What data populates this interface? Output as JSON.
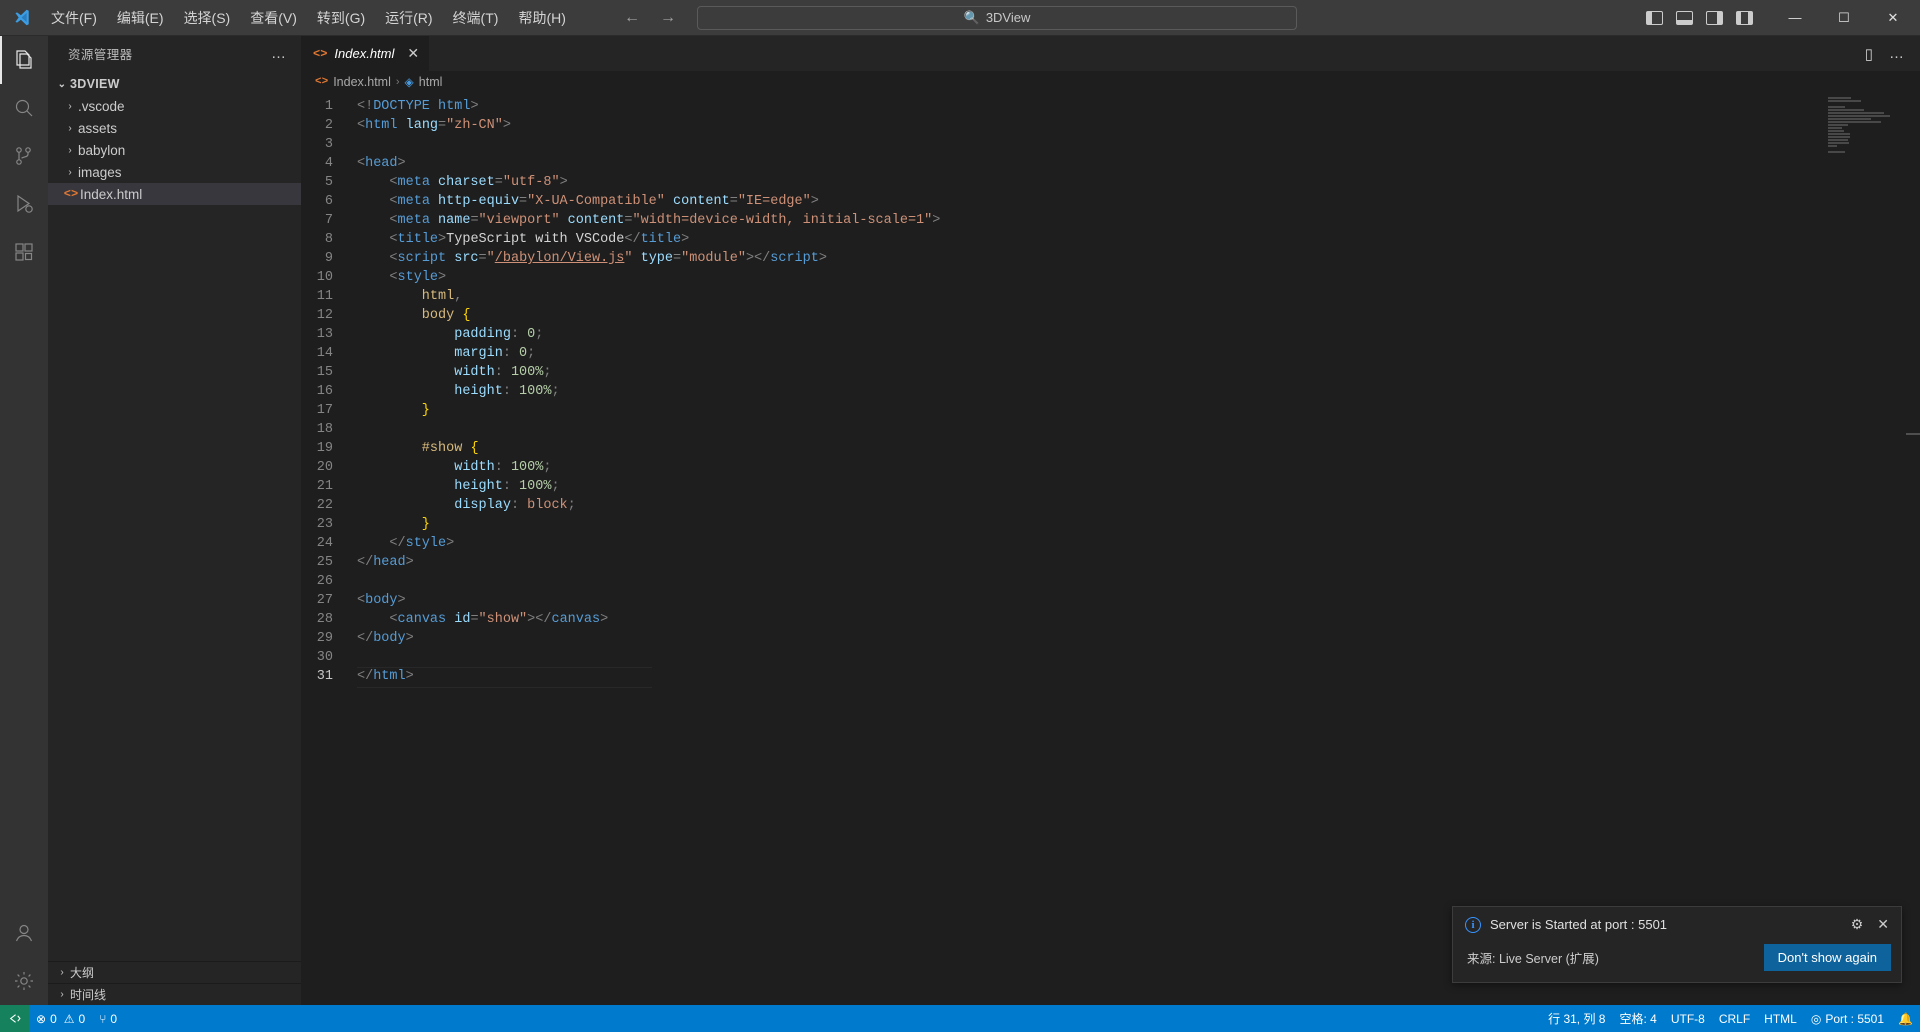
{
  "titlebar": {
    "menus": [
      "文件(F)",
      "编辑(E)",
      "选择(S)",
      "查看(V)",
      "转到(G)",
      "运行(R)",
      "终端(T)",
      "帮助(H)"
    ],
    "back_icon": "←",
    "forward_icon": "→",
    "search_icon": "search-icon",
    "search_text": "3DView",
    "minimize": "—",
    "maximize": "☐",
    "close": "✕"
  },
  "activitybar": {
    "items": [
      {
        "name": "explorer",
        "icon": "files-icon",
        "active": true
      },
      {
        "name": "search",
        "icon": "search-icon",
        "active": false
      },
      {
        "name": "source-control",
        "icon": "source-control-icon",
        "active": false
      },
      {
        "name": "run-debug",
        "icon": "run-debug-icon",
        "active": false
      },
      {
        "name": "extensions",
        "icon": "extensions-icon",
        "active": false
      }
    ],
    "bottom": [
      {
        "name": "accounts",
        "icon": "account-icon"
      },
      {
        "name": "settings",
        "icon": "gear-icon"
      }
    ]
  },
  "sidebar": {
    "title": "资源管理器",
    "more_actions": "…",
    "root": {
      "label": "3DVIEW",
      "twisty": "⌄"
    },
    "items": [
      {
        "label": ".vscode",
        "twisty": "›",
        "icon": "folder-icon",
        "selected": false
      },
      {
        "label": "assets",
        "twisty": "›",
        "icon": "folder-icon",
        "selected": false
      },
      {
        "label": "babylon",
        "twisty": "›",
        "icon": "folder-icon",
        "selected": false
      },
      {
        "label": "images",
        "twisty": "›",
        "icon": "folder-icon",
        "selected": false
      },
      {
        "label": "Index.html",
        "twisty": "",
        "icon": "html-file-icon",
        "selected": true
      }
    ],
    "panels": [
      {
        "label": "大纲",
        "twisty": "›"
      },
      {
        "label": "时间线",
        "twisty": "›"
      }
    ]
  },
  "editor": {
    "tab": {
      "label": "Index.html",
      "icon": "html-file-icon",
      "close": "✕"
    },
    "tab_actions": [
      {
        "name": "split-editor-icon",
        "glyph": "▯"
      },
      {
        "name": "more-actions-icon",
        "glyph": "…"
      }
    ],
    "breadcrumb": [
      {
        "label": "Index.html",
        "icon": "html-file-icon"
      },
      {
        "label": "html",
        "icon": "symbol-cube-icon"
      }
    ],
    "breadcrumb_separator": "›",
    "lines": [
      {
        "n": 1,
        "tokens": [
          {
            "c": "b",
            "t": "<!"
          },
          {
            "c": "t",
            "t": "DOCTYPE"
          },
          {
            "c": "txt",
            "t": " "
          },
          {
            "c": "t",
            "t": "html"
          },
          {
            "c": "b",
            "t": ">"
          }
        ]
      },
      {
        "n": 2,
        "tokens": [
          {
            "c": "b",
            "t": "<"
          },
          {
            "c": "t",
            "t": "html"
          },
          {
            "c": "txt",
            "t": " "
          },
          {
            "c": "a",
            "t": "lang"
          },
          {
            "c": "b",
            "t": "="
          },
          {
            "c": "s",
            "t": "\"zh-CN\""
          },
          {
            "c": "b",
            "t": ">"
          }
        ]
      },
      {
        "n": 3,
        "tokens": []
      },
      {
        "n": 4,
        "tokens": [
          {
            "c": "b",
            "t": "<"
          },
          {
            "c": "t",
            "t": "head"
          },
          {
            "c": "b",
            "t": ">"
          }
        ]
      },
      {
        "n": 5,
        "tokens": [
          {
            "c": "b",
            "t": "    <"
          },
          {
            "c": "t",
            "t": "meta"
          },
          {
            "c": "txt",
            "t": " "
          },
          {
            "c": "a",
            "t": "charset"
          },
          {
            "c": "b",
            "t": "="
          },
          {
            "c": "s",
            "t": "\"utf-8\""
          },
          {
            "c": "b",
            "t": ">"
          }
        ]
      },
      {
        "n": 6,
        "tokens": [
          {
            "c": "b",
            "t": "    <"
          },
          {
            "c": "t",
            "t": "meta"
          },
          {
            "c": "txt",
            "t": " "
          },
          {
            "c": "a",
            "t": "http-equiv"
          },
          {
            "c": "b",
            "t": "="
          },
          {
            "c": "s",
            "t": "\"X-UA-Compatible\""
          },
          {
            "c": "txt",
            "t": " "
          },
          {
            "c": "a",
            "t": "content"
          },
          {
            "c": "b",
            "t": "="
          },
          {
            "c": "s",
            "t": "\"IE=edge\""
          },
          {
            "c": "b",
            "t": ">"
          }
        ]
      },
      {
        "n": 7,
        "tokens": [
          {
            "c": "b",
            "t": "    <"
          },
          {
            "c": "t",
            "t": "meta"
          },
          {
            "c": "txt",
            "t": " "
          },
          {
            "c": "a",
            "t": "name"
          },
          {
            "c": "b",
            "t": "="
          },
          {
            "c": "s",
            "t": "\"viewport\""
          },
          {
            "c": "txt",
            "t": " "
          },
          {
            "c": "a",
            "t": "content"
          },
          {
            "c": "b",
            "t": "="
          },
          {
            "c": "s",
            "t": "\"width=device-width, initial-scale=1\""
          },
          {
            "c": "b",
            "t": ">"
          }
        ]
      },
      {
        "n": 8,
        "tokens": [
          {
            "c": "b",
            "t": "    <"
          },
          {
            "c": "t",
            "t": "title"
          },
          {
            "c": "b",
            "t": ">"
          },
          {
            "c": "txt",
            "t": "TypeScript with VSCode"
          },
          {
            "c": "b",
            "t": "</"
          },
          {
            "c": "t",
            "t": "title"
          },
          {
            "c": "b",
            "t": ">"
          }
        ]
      },
      {
        "n": 9,
        "tokens": [
          {
            "c": "b",
            "t": "    <"
          },
          {
            "c": "t",
            "t": "script"
          },
          {
            "c": "txt",
            "t": " "
          },
          {
            "c": "a",
            "t": "src"
          },
          {
            "c": "b",
            "t": "="
          },
          {
            "c": "s",
            "t": "\""
          },
          {
            "c": "lnk",
            "t": "/babylon/View.js"
          },
          {
            "c": "s",
            "t": "\""
          },
          {
            "c": "txt",
            "t": " "
          },
          {
            "c": "a",
            "t": "type"
          },
          {
            "c": "b",
            "t": "="
          },
          {
            "c": "s",
            "t": "\"module\""
          },
          {
            "c": "b",
            "t": "></"
          },
          {
            "c": "t",
            "t": "script"
          },
          {
            "c": "b",
            "t": ">"
          }
        ]
      },
      {
        "n": 10,
        "tokens": [
          {
            "c": "b",
            "t": "    <"
          },
          {
            "c": "t",
            "t": "style"
          },
          {
            "c": "b",
            "t": ">"
          }
        ]
      },
      {
        "n": 11,
        "tokens": [
          {
            "c": "sel",
            "t": "        html"
          },
          {
            "c": "b",
            "t": ","
          }
        ]
      },
      {
        "n": 12,
        "tokens": [
          {
            "c": "sel",
            "t": "        body"
          },
          {
            "c": "txt",
            "t": " "
          },
          {
            "c": "br",
            "t": "{"
          }
        ]
      },
      {
        "n": 13,
        "tokens": [
          {
            "c": "a",
            "t": "            padding"
          },
          {
            "c": "b",
            "t": ":"
          },
          {
            "c": "txt",
            "t": " "
          },
          {
            "c": "num",
            "t": "0"
          },
          {
            "c": "b",
            "t": ";"
          }
        ]
      },
      {
        "n": 14,
        "tokens": [
          {
            "c": "a",
            "t": "            margin"
          },
          {
            "c": "b",
            "t": ":"
          },
          {
            "c": "txt",
            "t": " "
          },
          {
            "c": "num",
            "t": "0"
          },
          {
            "c": "b",
            "t": ";"
          }
        ]
      },
      {
        "n": 15,
        "tokens": [
          {
            "c": "a",
            "t": "            width"
          },
          {
            "c": "b",
            "t": ":"
          },
          {
            "c": "txt",
            "t": " "
          },
          {
            "c": "num",
            "t": "100%"
          },
          {
            "c": "b",
            "t": ";"
          }
        ]
      },
      {
        "n": 16,
        "tokens": [
          {
            "c": "a",
            "t": "            height"
          },
          {
            "c": "b",
            "t": ":"
          },
          {
            "c": "txt",
            "t": " "
          },
          {
            "c": "num",
            "t": "100%"
          },
          {
            "c": "b",
            "t": ";"
          }
        ]
      },
      {
        "n": 17,
        "tokens": [
          {
            "c": "br",
            "t": "        }"
          }
        ]
      },
      {
        "n": 18,
        "tokens": []
      },
      {
        "n": 19,
        "tokens": [
          {
            "c": "sel",
            "t": "        #show"
          },
          {
            "c": "txt",
            "t": " "
          },
          {
            "c": "br",
            "t": "{"
          }
        ]
      },
      {
        "n": 20,
        "tokens": [
          {
            "c": "a",
            "t": "            width"
          },
          {
            "c": "b",
            "t": ":"
          },
          {
            "c": "txt",
            "t": " "
          },
          {
            "c": "num",
            "t": "100%"
          },
          {
            "c": "b",
            "t": ";"
          }
        ]
      },
      {
        "n": 21,
        "tokens": [
          {
            "c": "a",
            "t": "            height"
          },
          {
            "c": "b",
            "t": ":"
          },
          {
            "c": "txt",
            "t": " "
          },
          {
            "c": "num",
            "t": "100%"
          },
          {
            "c": "b",
            "t": ";"
          }
        ]
      },
      {
        "n": 22,
        "tokens": [
          {
            "c": "a",
            "t": "            display"
          },
          {
            "c": "b",
            "t": ":"
          },
          {
            "c": "txt",
            "t": " "
          },
          {
            "c": "s",
            "t": "block"
          },
          {
            "c": "b",
            "t": ";"
          }
        ]
      },
      {
        "n": 23,
        "tokens": [
          {
            "c": "br",
            "t": "        }"
          }
        ]
      },
      {
        "n": 24,
        "tokens": [
          {
            "c": "b",
            "t": "    </"
          },
          {
            "c": "t",
            "t": "style"
          },
          {
            "c": "b",
            "t": ">"
          }
        ]
      },
      {
        "n": 25,
        "tokens": [
          {
            "c": "b",
            "t": "</"
          },
          {
            "c": "t",
            "t": "head"
          },
          {
            "c": "b",
            "t": ">"
          }
        ]
      },
      {
        "n": 26,
        "tokens": []
      },
      {
        "n": 27,
        "tokens": [
          {
            "c": "b",
            "t": "<"
          },
          {
            "c": "t",
            "t": "body"
          },
          {
            "c": "b",
            "t": ">"
          }
        ]
      },
      {
        "n": 28,
        "tokens": [
          {
            "c": "b",
            "t": "    <"
          },
          {
            "c": "t",
            "t": "canvas"
          },
          {
            "c": "txt",
            "t": " "
          },
          {
            "c": "a",
            "t": "id"
          },
          {
            "c": "b",
            "t": "="
          },
          {
            "c": "s",
            "t": "\"show\""
          },
          {
            "c": "b",
            "t": "></"
          },
          {
            "c": "t",
            "t": "canvas"
          },
          {
            "c": "b",
            "t": ">"
          }
        ]
      },
      {
        "n": 29,
        "tokens": [
          {
            "c": "b",
            "t": "</"
          },
          {
            "c": "t",
            "t": "body"
          },
          {
            "c": "b",
            "t": ">"
          }
        ]
      },
      {
        "n": 30,
        "tokens": []
      },
      {
        "n": 31,
        "tokens": [
          {
            "c": "b",
            "t": "</"
          },
          {
            "c": "t",
            "t": "html"
          },
          {
            "c": "b",
            "t": ">"
          }
        ],
        "current": true
      }
    ]
  },
  "notification": {
    "icon": "info-icon",
    "message": "Server is Started at port : 5501",
    "gear_icon": "gear-icon",
    "close_icon": "✕",
    "source": "来源: Live Server (扩展)",
    "button": "Don't show again"
  },
  "statusbar": {
    "remote_icon": "remote-icon",
    "problems": [
      {
        "icon": "error-icon",
        "glyph": "⊗",
        "value": "0"
      },
      {
        "icon": "warning-icon",
        "glyph": "⚠",
        "value": "0"
      }
    ],
    "ports": {
      "icon": "ports-icon",
      "glyph": "⑂",
      "value": "0"
    },
    "right": [
      {
        "name": "cursor-position",
        "label": "行 31, 列 8"
      },
      {
        "name": "indentation",
        "label": "空格: 4"
      },
      {
        "name": "encoding",
        "label": "UTF-8"
      },
      {
        "name": "eol",
        "label": "CRLF"
      },
      {
        "name": "language-mode",
        "label": "HTML"
      },
      {
        "name": "live-server-port",
        "label": "Port : 5501",
        "icon": "broadcast-icon"
      }
    ],
    "bell_icon": "bell-icon"
  },
  "colors": {
    "accent": "#007acc",
    "html_orange": "#e37933",
    "button_blue": "#0e639c",
    "remote_green": "#16825d"
  }
}
